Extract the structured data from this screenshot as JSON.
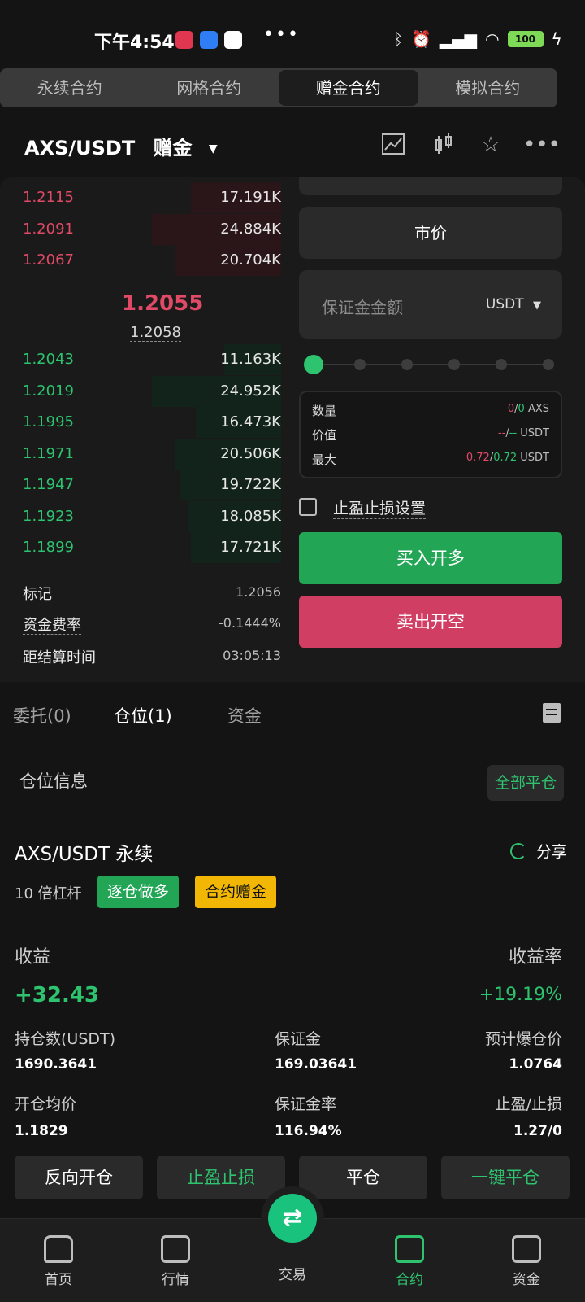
{
  "status_bar": {
    "time": "下午4:54",
    "battery": "100"
  },
  "top_tabs": [
    "永续合约",
    "网格合约",
    "赠金合约",
    "模拟合约"
  ],
  "header": {
    "pair": "AXS/USDT",
    "mode": "赠金"
  },
  "order_book": {
    "asks": [
      {
        "price": "1.2115",
        "qty": "17.191K",
        "depth": 0.35
      },
      {
        "price": "1.2091",
        "qty": "24.884K",
        "depth": 0.5
      },
      {
        "price": "1.2067",
        "qty": "20.704K",
        "depth": 0.41
      }
    ],
    "last_price": "1.2055",
    "mark_price": "1.2058",
    "bids": [
      {
        "price": "1.2043",
        "qty": "11.163K",
        "depth": 0.22
      },
      {
        "price": "1.2019",
        "qty": "24.952K",
        "depth": 0.5
      },
      {
        "price": "1.1995",
        "qty": "16.473K",
        "depth": 0.33
      },
      {
        "price": "1.1971",
        "qty": "20.506K",
        "depth": 0.41
      },
      {
        "price": "1.1947",
        "qty": "19.722K",
        "depth": 0.39
      },
      {
        "price": "1.1923",
        "qty": "18.085K",
        "depth": 0.36
      },
      {
        "price": "1.1899",
        "qty": "17.721K",
        "depth": 0.35
      }
    ],
    "info": [
      {
        "label": "标记",
        "value": "1.2056"
      },
      {
        "label": "资金费率",
        "value": "-0.1444%"
      },
      {
        "label": "距结算时间",
        "value": "03:05:13"
      }
    ]
  },
  "form": {
    "order_type": "市价",
    "margin_placeholder": "保证金金额",
    "unit": "USDT",
    "slider_value": 0,
    "qty_label": "数量",
    "qty_a": "0",
    "qty_b": "0",
    "qty_unit": "AXS",
    "value_label": "价值",
    "value_a": "--",
    "value_b": "--",
    "value_unit": "USDT",
    "max_label": "最大",
    "max_a": "0.72",
    "max_b": "0.72",
    "max_unit": "USDT",
    "tpsl_label": "止盈止损设置",
    "buy_label": "买入开多",
    "sell_label": "卖出开空"
  },
  "sub_tabs": {
    "orders": "委托(0)",
    "positions": "仓位(1)",
    "assets": "资金"
  },
  "position": {
    "section_title": "仓位信息",
    "close_all": "全部平仓",
    "symbol": "AXS/USDT 永续",
    "share": "分享",
    "leverage": "10 倍杠杆",
    "tag_mode": "逐仓做多",
    "tag_bonus": "合约赠金",
    "pnl_label": "收益",
    "pnl_value": "+32.43",
    "roe_label": "收益率",
    "roe_value": "+19.19%",
    "size_label": "持仓数(USDT)",
    "size_value": "1690.3641",
    "margin_label": "保证金",
    "margin_value": "169.03641",
    "liq_label": "预计爆仓价",
    "liq_value": "1.0764",
    "entry_label": "开仓均价",
    "entry_value": "1.1829",
    "margin_ratio_label": "保证金率",
    "margin_ratio_value": "116.94%",
    "tpsl_label": "止盈/止损",
    "tpsl_value": "1.27/0",
    "actions": [
      "反向开仓",
      "止盈止损",
      "平仓",
      "一键平仓"
    ]
  },
  "bottom_nav": [
    {
      "label": "首页",
      "icon": "home-icon"
    },
    {
      "label": "行情",
      "icon": "market-icon"
    },
    {
      "label": "交易",
      "icon": "swap-icon"
    },
    {
      "label": "合约",
      "icon": "contract-icon"
    },
    {
      "label": "资金",
      "icon": "wallet-icon"
    }
  ],
  "colors": {
    "green": "#2ec36f",
    "red": "#e04a66",
    "buy": "#22a656",
    "sell": "#d13e64",
    "bonus": "#f2b705"
  }
}
